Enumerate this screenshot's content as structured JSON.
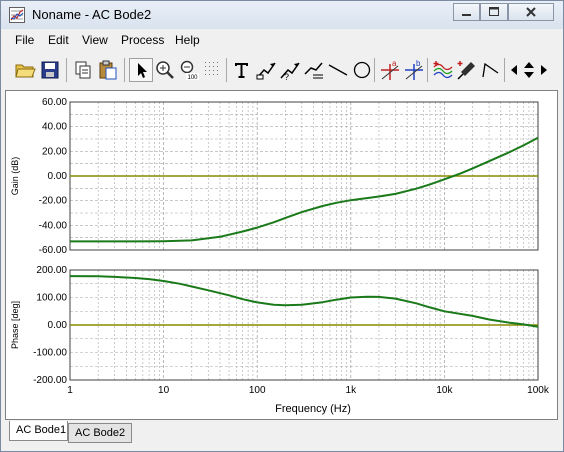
{
  "window": {
    "title": "Noname - AC Bode2"
  },
  "menu": [
    "File",
    "Edit",
    "View",
    "Process",
    "Help"
  ],
  "toolbar": {
    "icons": [
      "open-folder-icon",
      "save-icon",
      "copy-icon",
      "paste-icon",
      "pointer-icon",
      "zoom-in-icon",
      "zoom-100-icon",
      "grid-icon",
      "text-icon",
      "arrow-annotation-icon",
      "help-annotation-icon",
      "label-annotation-icon",
      "line-icon",
      "circle-icon",
      "cursor-a-icon",
      "cursor-b-icon",
      "curves-icon",
      "probe-icon",
      "polyline-icon",
      "scroll-left-icon",
      "scroll-updown-icon",
      "scroll-right-icon"
    ]
  },
  "tabs": [
    "AC Bode1",
    "AC Bode2"
  ],
  "colors": {
    "curve": "#1a7a1a",
    "zero_line": "#8a8a00",
    "grid": "#a8a8a8"
  },
  "chart_data": [
    {
      "type": "line",
      "ylabel": "Gain (dB)",
      "xscale": "log",
      "xlim": [
        1,
        100000
      ],
      "ylim": [
        -60,
        60
      ],
      "yticks": [
        "60.00",
        "40.00",
        "20.00",
        "0.00",
        "-20.00",
        "-40.00",
        "-60.00"
      ],
      "yticks_values": [
        60,
        40,
        20,
        0,
        -20,
        -40,
        -60
      ],
      "reference_line": 0,
      "series": [
        {
          "x": [
            1,
            2,
            5,
            10,
            20,
            40,
            70,
            100,
            150,
            200,
            300,
            500,
            700,
            1000,
            2000,
            3000,
            5000,
            7000,
            10000,
            15000,
            20000,
            30000,
            50000,
            70000,
            100000
          ],
          "values": [
            -53,
            -53,
            -53,
            -52.9,
            -52.2,
            -49.3,
            -45,
            -41.8,
            -37.5,
            -34,
            -29.3,
            -24.3,
            -21.7,
            -19.6,
            -16.6,
            -14.5,
            -10.3,
            -6.8,
            -2.7,
            2.2,
            6.2,
            12,
            19.5,
            24.8,
            31
          ]
        }
      ]
    },
    {
      "type": "line",
      "ylabel": "Phase [deg]",
      "xlabel": "Frequency (Hz)",
      "xscale": "log",
      "xlim": [
        1,
        100000
      ],
      "ylim": [
        -200,
        200
      ],
      "yticks": [
        "200.00",
        "100.00",
        "0.00",
        "-100.00",
        "-200.00"
      ],
      "yticks_values": [
        200,
        100,
        0,
        -100,
        -200
      ],
      "xticks": [
        "1",
        "10",
        "100",
        "1k",
        "10k",
        "100k"
      ],
      "xticks_values": [
        1,
        10,
        100,
        1000,
        10000,
        100000
      ],
      "reference_line": 0,
      "series": [
        {
          "x": [
            1,
            2,
            3,
            5,
            7,
            10,
            15,
            20,
            30,
            50,
            70,
            100,
            150,
            200,
            300,
            500,
            700,
            1000,
            1500,
            2000,
            3000,
            5000,
            7000,
            10000,
            20000,
            30000,
            50000,
            70000,
            100000
          ],
          "values": [
            178,
            177,
            175,
            171,
            167,
            160,
            150,
            140,
            126,
            108,
            94,
            82,
            74,
            72,
            74,
            83,
            92,
            100,
            103,
            102,
            96,
            79,
            64,
            50,
            33,
            20,
            8,
            2,
            -6
          ]
        }
      ]
    }
  ]
}
